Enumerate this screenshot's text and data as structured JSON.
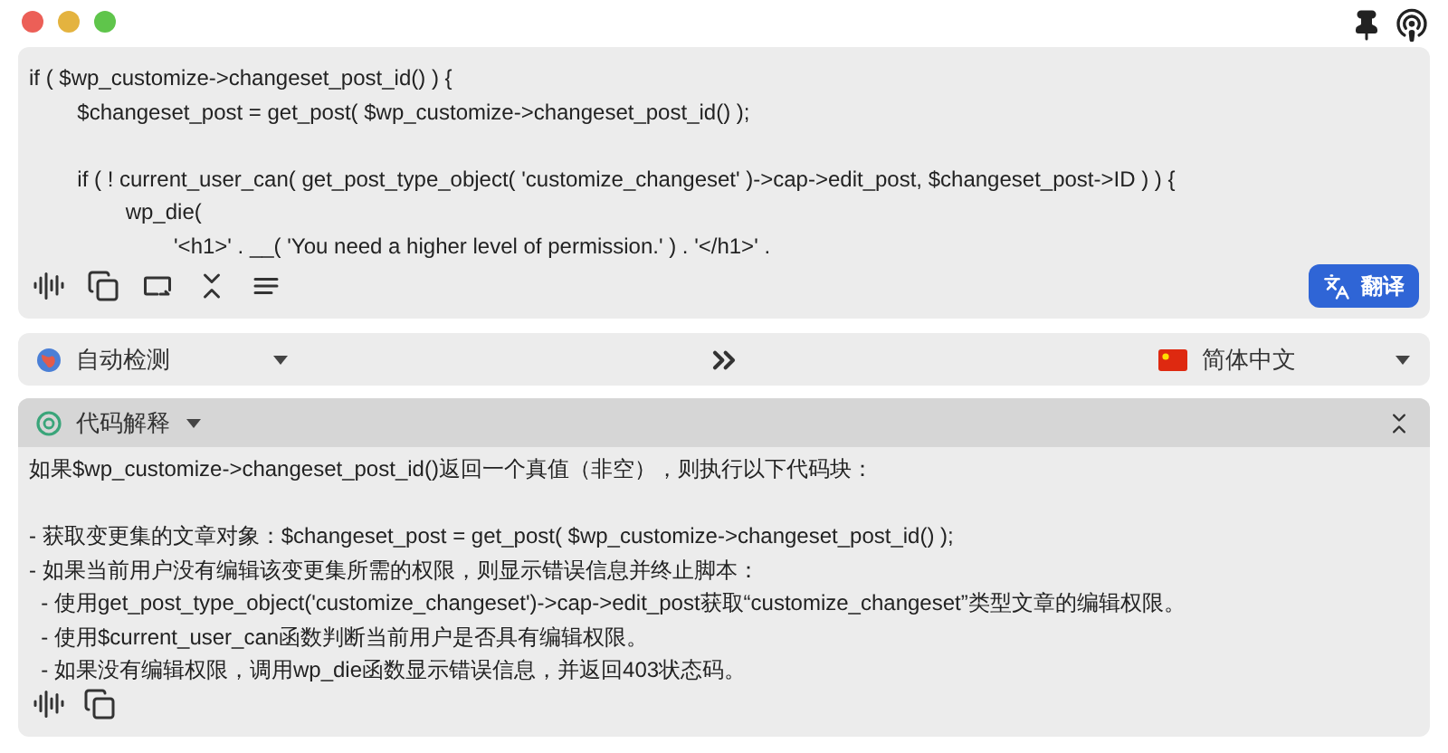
{
  "source": {
    "code_blocks": [
      [
        "if ( $wp_customize->changeset_post_id() ) {",
        "\t$changeset_post = get_post( $wp_customize->changeset_post_id() );"
      ],
      [
        "\tif ( ! current_user_can( get_post_type_object( 'customize_changeset' )->cap->edit_post, $changeset_post->ID ) ) {",
        "\t\twp_die(",
        "\t\t\t'<h1>' . __( 'You need a higher level of permission.' ) . '</h1>' ."
      ]
    ],
    "translate_button": "翻译"
  },
  "languages": {
    "source": "自动检测",
    "target": "简体中文"
  },
  "result": {
    "service": "代码解释",
    "paragraphs": [
      [
        "如果$wp_customize->changeset_post_id()返回一个真值（非空），则执行以下代码块："
      ],
      [
        "- 获取变更集的文章对象：$changeset_post = get_post( $wp_customize->changeset_post_id() );",
        "- 如果当前用户没有编辑该变更集所需的权限，则显示错误信息并终止脚本：",
        "  - 使用get_post_type_object('customize_changeset')->cap->edit_post获取“customize_changeset”类型文章的编辑权限。",
        "  - 使用$current_user_can函数判断当前用户是否具有编辑权限。",
        "  - 如果没有编辑权限，调用wp_die函数显示错误信息，并返回403状态码。"
      ]
    ]
  }
}
